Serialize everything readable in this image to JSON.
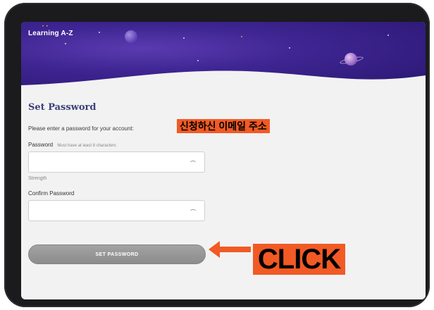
{
  "brand": {
    "logo_text": "Learning A-Z"
  },
  "form": {
    "title": "Set Password",
    "description": "Please enter a password for your account:",
    "account_placeholder_overlay": "신청하신 이메일 주소",
    "password_label": "Password",
    "password_hint": "Must have at least 8 characters",
    "strength_label": "Strength",
    "confirm_label": "Confirm Password",
    "submit_label": "SET PASSWORD"
  },
  "annotation": {
    "callout_text": "CLICK",
    "accent_color": "#f15a24"
  },
  "icons": {
    "password_toggle": "eye-closed-icon",
    "confirm_toggle": "eye-closed-icon",
    "callout_arrow": "arrow-left-icon"
  },
  "colors": {
    "banner": "#3e2592",
    "title": "#3a3f7a",
    "button": "#999999"
  }
}
